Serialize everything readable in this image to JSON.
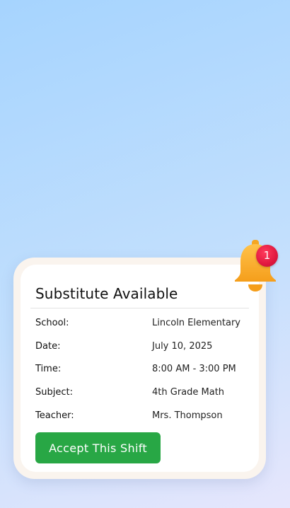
{
  "card": {
    "title": "Substitute Available",
    "details": [
      {
        "label": "School:",
        "value": "Lincoln Elementary"
      },
      {
        "label": "Date:",
        "value": "July 10, 2025"
      },
      {
        "label": "Time:",
        "value": "8:00 AM - 3:00 PM"
      },
      {
        "label": "Subject:",
        "value": "4th Grade Math"
      },
      {
        "label": "Teacher:",
        "value": "Mrs. Thompson"
      }
    ],
    "accept_label": "Accept This Shift"
  },
  "notification": {
    "icon": "bell-icon",
    "badge_count": "1"
  },
  "colors": {
    "accent_green": "#28a745",
    "badge_red": "#e0183f",
    "bell_orange": "#f9a825"
  }
}
